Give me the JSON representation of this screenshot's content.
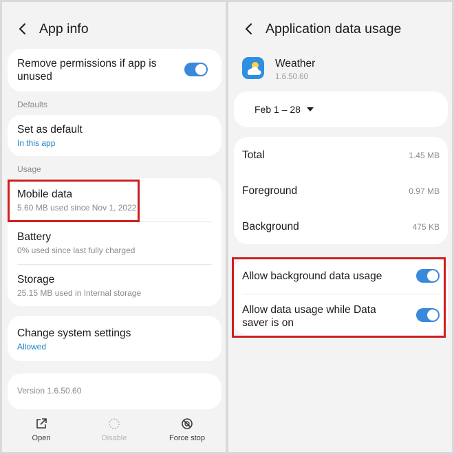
{
  "left": {
    "header": {
      "title": "App info"
    },
    "remove_permissions": {
      "label": "Remove permissions if app is unused",
      "enabled": true
    },
    "sections": {
      "defaults": "Defaults",
      "usage": "Usage"
    },
    "set_default": {
      "title": "Set as default",
      "subtitle": "In this app"
    },
    "mobile_data": {
      "title": "Mobile data",
      "subtitle": "5.60 MB used since Nov 1, 2022"
    },
    "battery": {
      "title": "Battery",
      "subtitle": "0% used since last fully charged"
    },
    "storage": {
      "title": "Storage",
      "subtitle": "25.15 MB used in Internal storage"
    },
    "system_settings": {
      "title": "Change system settings",
      "subtitle": "Allowed"
    },
    "version": "Version 1.6.50.60",
    "bottom": {
      "open": "Open",
      "disable": "Disable",
      "force_stop": "Force stop"
    }
  },
  "right": {
    "header": {
      "title": "Application data usage"
    },
    "app": {
      "name": "Weather",
      "version": "1.6.50.60"
    },
    "date_range": "Feb 1 – 28",
    "usage": {
      "total_label": "Total",
      "total_value": "1.45 MB",
      "foreground_label": "Foreground",
      "foreground_value": "0.97 MB",
      "background_label": "Background",
      "background_value": "475 KB"
    },
    "allow_background": {
      "label": "Allow background data usage",
      "enabled": true
    },
    "allow_data_saver": {
      "label": "Allow data usage while Data saver is on",
      "enabled": true
    }
  },
  "colors": {
    "accent": "#1a82c4",
    "toggle_on": "#3a88dc",
    "highlight": "#cc1f1f"
  },
  "icons": [
    "back-arrow-icon",
    "open-external-icon",
    "disable-icon",
    "force-stop-icon",
    "weather-app-icon",
    "dropdown-caret-icon"
  ]
}
